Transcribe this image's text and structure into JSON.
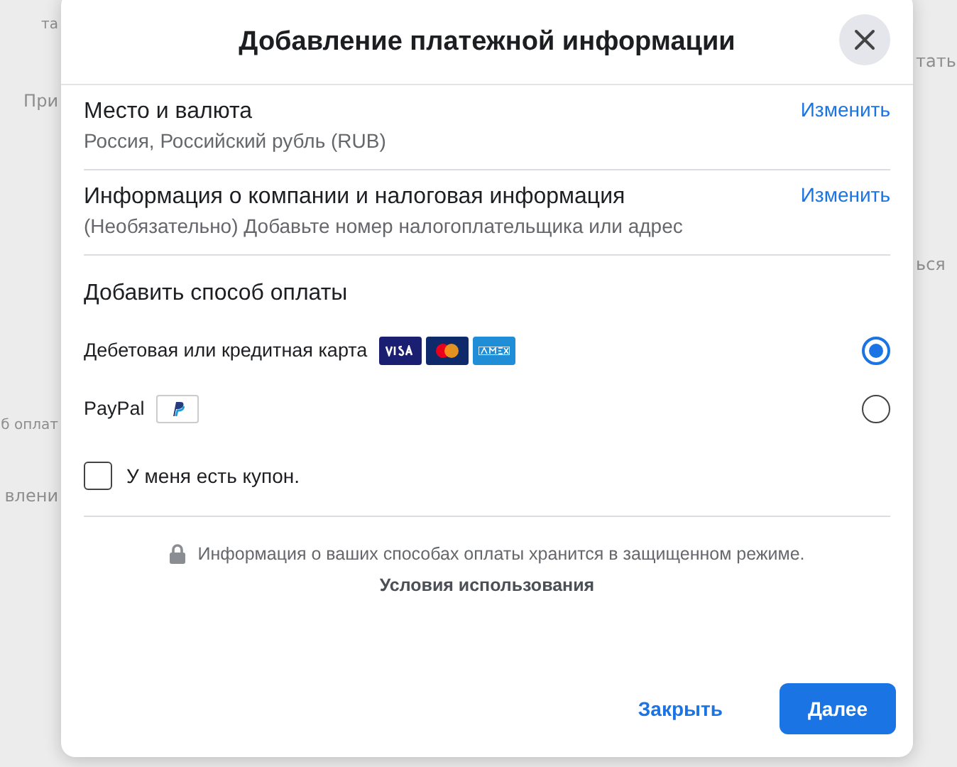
{
  "background": {
    "fragments": [
      {
        "text": "та",
        "kind": "small"
      },
      {
        "text": "При",
        "kind": "large"
      },
      {
        "text": "б оплат",
        "kind": "small"
      },
      {
        "text": "влени",
        "kind": "large"
      },
      {
        "text": "тать",
        "kind": "small"
      },
      {
        "text": "ься",
        "kind": "small"
      }
    ]
  },
  "dialog": {
    "title": "Добавление платежной информации",
    "sections": [
      {
        "title": "Место и валюта",
        "subtitle": "Россия, Российский рубль (RUB)",
        "action": "Изменить"
      },
      {
        "title": "Информация о компании и налоговая информация",
        "subtitle": "(Необязательно) Добавьте номер налогоплательщика или адрес",
        "action": "Изменить"
      }
    ],
    "payment": {
      "heading": "Добавить способ оплаты",
      "methods": [
        {
          "label": "Дебетовая или кредитная карта",
          "kind": "card",
          "selected": true
        },
        {
          "label": "PayPal",
          "kind": "paypal",
          "selected": false
        }
      ]
    },
    "coupon": {
      "label": "У меня есть купон.",
      "checked": false
    },
    "security_note": "Информация о ваших способах оплаты хранится в защищенном режиме.",
    "terms_link": "Условия использования",
    "buttons": [
      {
        "label": "Закрыть",
        "kind": "secondary"
      },
      {
        "label": "Далее",
        "kind": "primary"
      }
    ]
  }
}
